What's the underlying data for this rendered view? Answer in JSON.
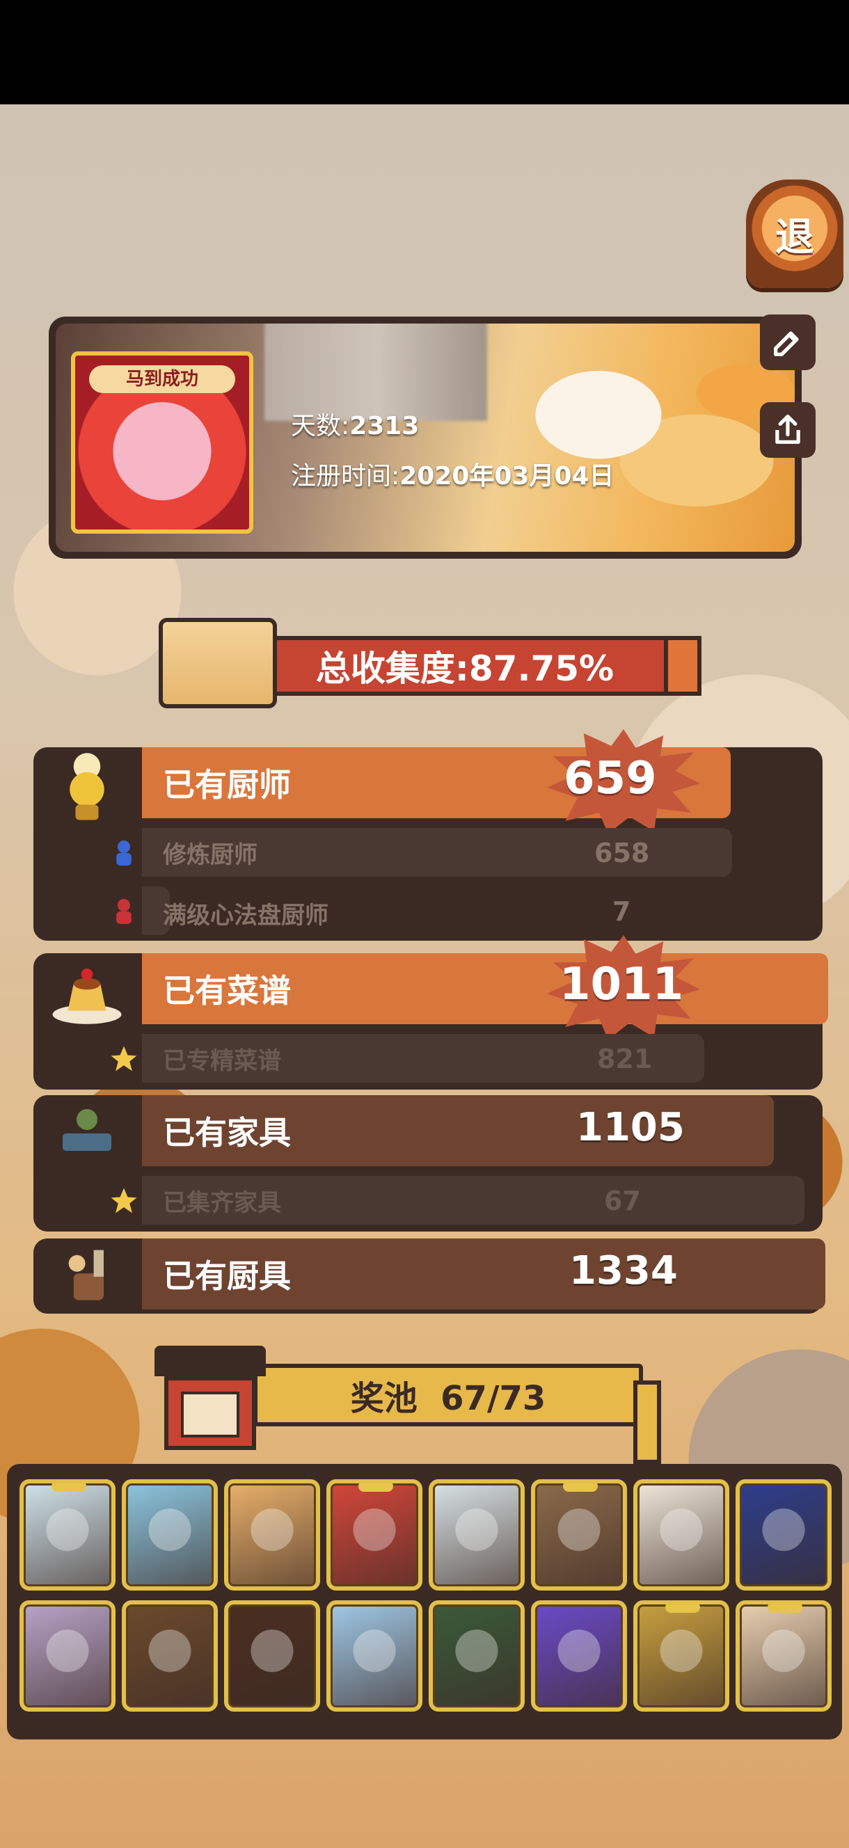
{
  "back_button": {
    "label": "退"
  },
  "profile": {
    "avatar_banner": "马到成功",
    "days_label": "天数:",
    "days_value": "2313",
    "register_label": "注册时间:",
    "register_value": "2020年03月04日"
  },
  "collection": {
    "label": "总收集度:87.75%"
  },
  "stats": {
    "chefs": {
      "label": "已有厨师",
      "count": "659"
    },
    "trained_chefs": {
      "label": "修炼厨师",
      "count": "658"
    },
    "maxed_chefs": {
      "label": "满级心法盘厨师",
      "count": "7"
    },
    "recipes": {
      "label": "已有菜谱",
      "count": "1011"
    },
    "mastered_recipes": {
      "label": "已专精菜谱",
      "count": "821"
    },
    "furniture": {
      "label": "已有家具",
      "count": "1105"
    },
    "furniture_sets": {
      "label": "已集齐家具",
      "count": "67"
    },
    "utensils": {
      "label": "已有厨具",
      "count": "1334"
    }
  },
  "prize_pool": {
    "label": "奖池",
    "progress": "67/73",
    "collected": 67,
    "total": 73
  },
  "prize_cards": [
    {
      "color": "#cfe3ea",
      "ribbon": true
    },
    {
      "color": "#8cc6e0",
      "ribbon": false
    },
    {
      "color": "#e8b06a",
      "ribbon": false
    },
    {
      "color": "#d3463a",
      "ribbon": true
    },
    {
      "color": "#d8e2e4",
      "ribbon": false
    },
    {
      "color": "#8c6a4a",
      "ribbon": true
    },
    {
      "color": "#efe6d8",
      "ribbon": false
    },
    {
      "color": "#2c3e8c",
      "ribbon": false
    },
    {
      "color": "#b8a3c8",
      "ribbon": false
    },
    {
      "color": "#6b4a2c",
      "ribbon": false
    },
    {
      "color": "#4a2e20",
      "ribbon": false
    },
    {
      "color": "#9fc8e6",
      "ribbon": false
    },
    {
      "color": "#3a5a3a",
      "ribbon": false
    },
    {
      "color": "#6a4ac8",
      "ribbon": false
    },
    {
      "color": "#c8a040",
      "ribbon": true
    },
    {
      "color": "#e8d0b0",
      "ribbon": true
    }
  ]
}
